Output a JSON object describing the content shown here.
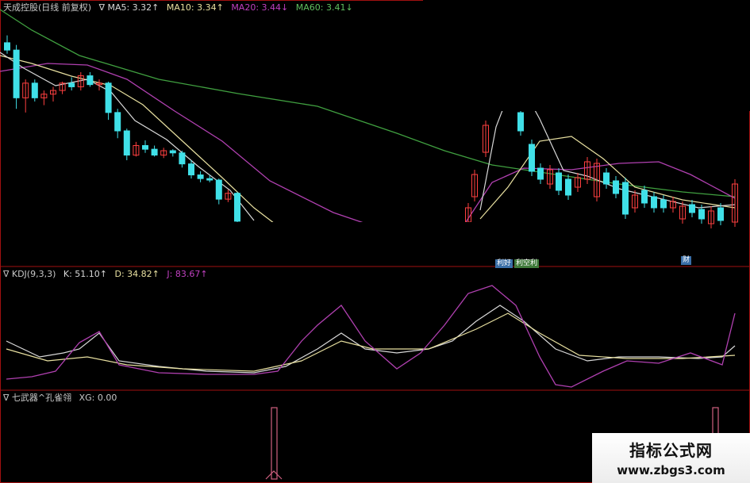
{
  "main_header": {
    "stock_name": "天成控股(日线 前复权)",
    "indicators": [
      {
        "label": "∇ MA5: 3.32↑",
        "color": "#d8d8d8"
      },
      {
        "label": "MA10: 3.34↑",
        "color": "#e8e0a0"
      },
      {
        "label": "MA20: 3.44↓",
        "color": "#c040c0"
      },
      {
        "label": "MA60: 3.41↓",
        "color": "#60c060"
      }
    ]
  },
  "kdj_header": {
    "title": "∇ KDJ(9,3,3)",
    "values": [
      {
        "label": "K: 51.10↑",
        "color": "#d8d8d8"
      },
      {
        "label": "D: 34.82↑",
        "color": "#e8e0a0"
      },
      {
        "label": "J: 83.67↑",
        "color": "#c040c0"
      }
    ]
  },
  "xg_header": {
    "title": "∇ 七武器^孔雀翎",
    "value": "XG: 0.00"
  },
  "tags": {
    "tag1": "利好",
    "tag2": "利空利",
    "tag3": "财"
  },
  "watermark": {
    "title": "指标公式网",
    "url": "www.zbgs3.com"
  },
  "colors": {
    "up": "#ff4040",
    "down": "#40e0e8",
    "ma5": "#d8d8d8",
    "ma10": "#e8e0a0",
    "ma20": "#b040b0",
    "ma60": "#40a040",
    "k": "#d8d8d8",
    "d": "#e8e0a0",
    "j": "#b040b0",
    "xg": "#d06080",
    "border": "#a01010"
  },
  "chart_data": {
    "type": "candlestick",
    "candles": [
      {
        "o": 5.95,
        "h": 6.05,
        "l": 5.8,
        "c": 5.85
      },
      {
        "o": 5.85,
        "h": 5.92,
        "l": 5.05,
        "c": 5.2
      },
      {
        "o": 5.2,
        "h": 5.45,
        "l": 5.0,
        "c": 5.4
      },
      {
        "o": 5.4,
        "h": 5.45,
        "l": 5.15,
        "c": 5.2
      },
      {
        "o": 5.2,
        "h": 5.3,
        "l": 5.1,
        "c": 5.25
      },
      {
        "o": 5.25,
        "h": 5.35,
        "l": 5.15,
        "c": 5.3
      },
      {
        "o": 5.3,
        "h": 5.42,
        "l": 5.25,
        "c": 5.4
      },
      {
        "o": 5.4,
        "h": 5.48,
        "l": 5.3,
        "c": 5.35
      },
      {
        "o": 5.35,
        "h": 5.55,
        "l": 5.3,
        "c": 5.5
      },
      {
        "o": 5.5,
        "h": 5.55,
        "l": 5.35,
        "c": 5.38
      },
      {
        "o": 5.38,
        "h": 5.45,
        "l": 5.3,
        "c": 5.4
      },
      {
        "o": 5.4,
        "h": 5.42,
        "l": 4.9,
        "c": 5.0
      },
      {
        "o": 5.0,
        "h": 5.05,
        "l": 4.65,
        "c": 4.75
      },
      {
        "o": 4.75,
        "h": 4.78,
        "l": 4.35,
        "c": 4.42
      },
      {
        "o": 4.42,
        "h": 4.6,
        "l": 4.4,
        "c": 4.55
      },
      {
        "o": 4.55,
        "h": 4.62,
        "l": 4.45,
        "c": 4.5
      },
      {
        "o": 4.5,
        "h": 4.55,
        "l": 4.4,
        "c": 4.42
      },
      {
        "o": 4.42,
        "h": 4.52,
        "l": 4.38,
        "c": 4.48
      },
      {
        "o": 4.48,
        "h": 4.5,
        "l": 4.4,
        "c": 4.45
      },
      {
        "o": 4.45,
        "h": 4.48,
        "l": 4.25,
        "c": 4.3
      },
      {
        "o": 4.3,
        "h": 4.35,
        "l": 4.1,
        "c": 4.15
      },
      {
        "o": 4.15,
        "h": 4.2,
        "l": 4.05,
        "c": 4.1
      },
      {
        "o": 4.1,
        "h": 4.15,
        "l": 4.05,
        "c": 4.08
      },
      {
        "o": 4.08,
        "h": 4.1,
        "l": 3.75,
        "c": 3.82
      },
      {
        "o": 3.82,
        "h": 3.95,
        "l": 3.78,
        "c": 3.9
      },
      {
        "o": 3.9,
        "h": 3.92,
        "l": 3.45,
        "c": 3.52
      }
    ],
    "title": "天成控股(日线 前复权)"
  }
}
